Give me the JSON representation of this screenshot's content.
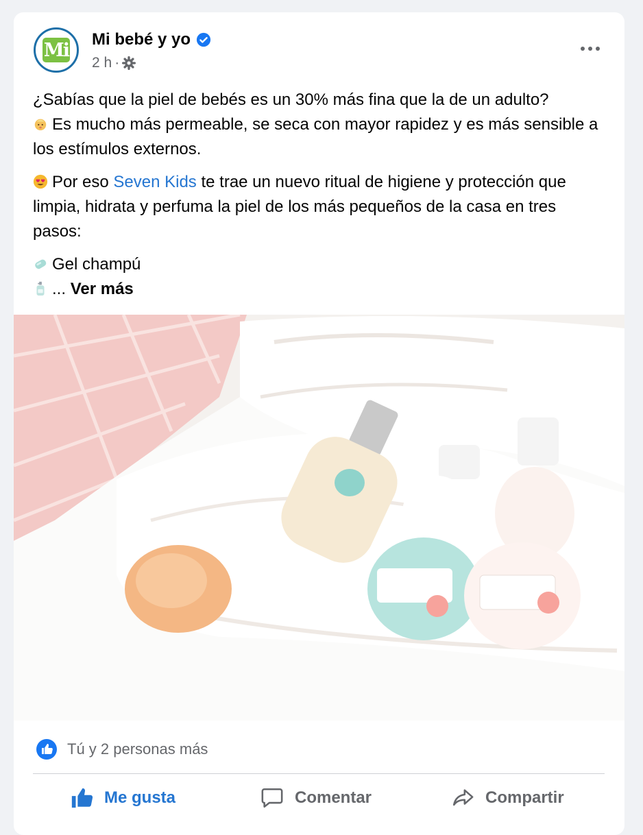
{
  "post": {
    "page_name": "Mi bebé y yo",
    "avatar_text": "Mi",
    "time": "2 h",
    "separator": "·",
    "paragraph1": "¿Sabías que la piel de bebés es un 30% más fina que la de un adulto?",
    "paragraph1b": "Es mucho más permeable, se seca con mayor rapidez y es más sensible a los estímulos externos.",
    "paragraph2_prefix": "Por eso",
    "paragraph2_link": "Seven Kids",
    "paragraph2_suffix": "te trae un nuevo ritual de higiene y protección que limpia, hidrata y perfuma la piel de los más pequeños de la casa en tres pasos:",
    "list_item1": "Gel champú",
    "truncation": "...",
    "see_more": "Ver más"
  },
  "reactions": {
    "summary": "Tú y 2 personas más"
  },
  "actions": {
    "like": "Me gusta",
    "comment": "Comentar",
    "share": "Compartir"
  },
  "colors": {
    "link": "#2576d1",
    "verified": "#1877f2",
    "secondary_text": "#65676b",
    "logo_green": "#7cc143"
  },
  "icons": [
    "verified-badge-icon",
    "gear-icon",
    "more-options-icon",
    "baby-emoji-icon",
    "heart-eyes-emoji-icon",
    "soap-emoji-icon",
    "lotion-bottle-emoji-icon",
    "like-reaction-icon",
    "thumbs-up-icon",
    "comment-icon",
    "share-icon"
  ]
}
